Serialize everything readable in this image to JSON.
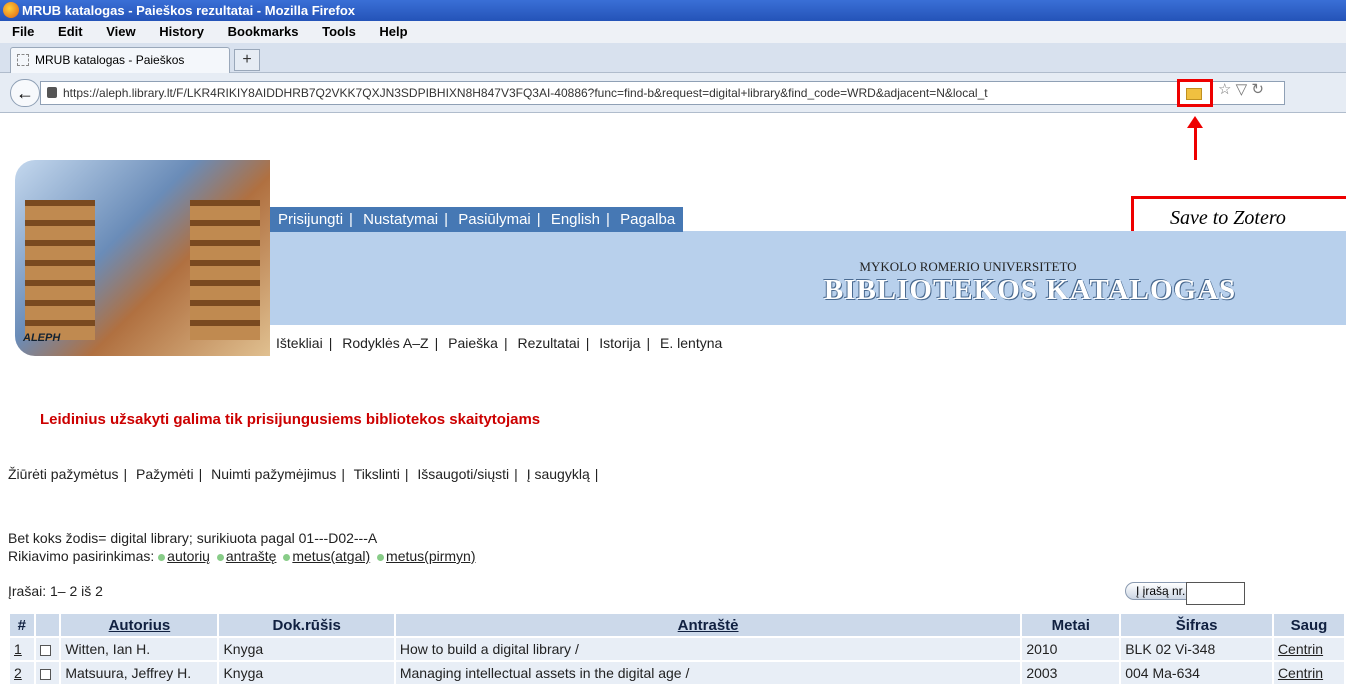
{
  "window": {
    "title": "MRUB katalogas - Paieškos rezultatai - Mozilla Firefox"
  },
  "menu": [
    "File",
    "Edit",
    "View",
    "History",
    "Bookmarks",
    "Tools",
    "Help"
  ],
  "tab": {
    "label": "MRUB katalogas - Paieškos rezultatai",
    "new_tab": "+"
  },
  "url": "https://aleph.library.lt/F/LKR4RIKIY8AIDDHRB7Q2VKK7QXJN3SDPIBHIXN8H847V3FQ3AI-40886?func=find-b&request=digital+library&find_code=WRD&adjacent=N&local_t",
  "annotation": {
    "label": "Save to Zotero"
  },
  "logo": {
    "aleph": "ALEPH"
  },
  "topnav": [
    "Prisijungti",
    "Nustatymai",
    "Pasiūlymai",
    "English",
    "Pagalba"
  ],
  "header": {
    "university": "MYKOLO ROMERIO UNIVERSITETO",
    "catalog": "BIBLIOTEKOS KATALOGAS"
  },
  "subnav": [
    "Ištekliai",
    "Rodyklės A–Z",
    "Paieška",
    "Rezultatai",
    "Istorija",
    "E. lentyna"
  ],
  "notice": "Leidinius užsakyti galima tik prisijungusiems bibliotekos skaitytojams",
  "actions": [
    "Žiūrėti pažymėtus",
    "Pažymėti",
    "Nuimti pažymėjimus",
    "Tikslinti",
    "Išsaugoti/siųsti",
    "Į saugyklą"
  ],
  "query": "Bet koks žodis= digital library; surikiuota pagal 01---D02---A",
  "sort": {
    "label": "Rikiavimo pasirinkimas:",
    "options": [
      "autorių",
      "antraštę",
      "metus(atgal)",
      "metus(pirmyn)"
    ]
  },
  "records": "Įrašai: 1– 2 iš 2",
  "jump_button": "Į įrašą nr.:",
  "table": {
    "headers": [
      "#",
      "Autorius",
      "Dok.rūšis",
      "Antraštė",
      "Metai",
      "Šifras",
      "Saug"
    ],
    "rows": [
      {
        "num": "1",
        "author": "Witten, Ian H.",
        "type": "Knyga",
        "title": "How to build a digital library /",
        "year": "2010",
        "code": "BLK 02 Vi-348",
        "loc": "Centrin"
      },
      {
        "num": "2",
        "author": "Matsuura, Jeffrey H.",
        "type": "Knyga",
        "title": "Managing intellectual assets in the digital age /",
        "year": "2003",
        "code": "004 Ma-634",
        "loc": "Centrin"
      }
    ]
  }
}
